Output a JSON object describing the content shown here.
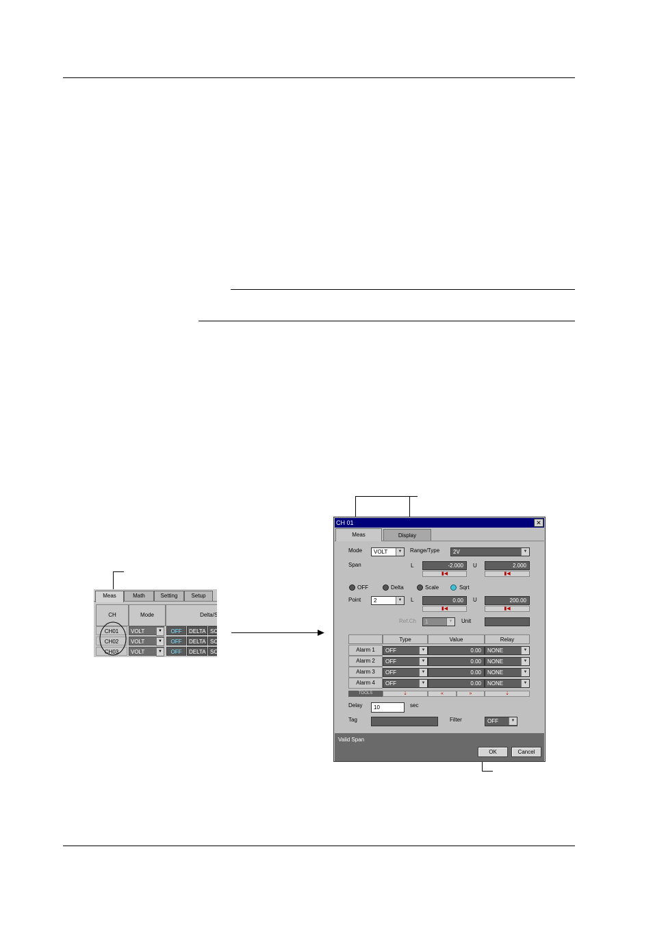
{
  "mini_table": {
    "tabs": [
      "Meas",
      "Math",
      "Setting",
      "Setup"
    ],
    "headers": {
      "ch": "CH",
      "mode": "Mode",
      "delta_scale": "Delta/Scale"
    },
    "rows": [
      {
        "ch": "CH01",
        "mode": "VOLT",
        "off": "OFF",
        "delta": "DELTA",
        "sc": "SC"
      },
      {
        "ch": "CH02",
        "mode": "VOLT",
        "off": "OFF",
        "delta": "DELTA",
        "sc": "SC"
      },
      {
        "ch": "CH03",
        "mode": "VOLT",
        "off": "OFF",
        "delta": "DELTA",
        "sc": "SC"
      }
    ]
  },
  "dialog": {
    "title": "CH 01",
    "close_glyph": "✕",
    "tabs": [
      "Meas",
      "Display"
    ],
    "mode_label": "Mode",
    "mode_value": "VOLT",
    "range_label": "Range/Type",
    "range_value": "2V",
    "span_label": "Span",
    "l_label": "L",
    "u_label": "U",
    "span_l": "-2.000",
    "span_u": "2.000",
    "radios": [
      {
        "label": "OFF",
        "selected": false
      },
      {
        "label": "Delta",
        "selected": false
      },
      {
        "label": "Scale",
        "selected": false
      },
      {
        "label": "Sqrt",
        "selected": true
      }
    ],
    "point_label": "Point",
    "point_value": "2",
    "point_l": "0.00",
    "point_u": "200.00",
    "refch_label": "Ref.Ch",
    "refch_value": "1",
    "unit_label": "Unit",
    "unit_value": "",
    "alarm_headers": {
      "type": "Type",
      "value": "Value",
      "relay": "Relay"
    },
    "alarms": [
      {
        "name": "Alarm 1",
        "type": "OFF",
        "value": "0.00",
        "relay": "NONE"
      },
      {
        "name": "Alarm 2",
        "type": "OFF",
        "value": "0.00",
        "relay": "NONE"
      },
      {
        "name": "Alarm 3",
        "type": "OFF",
        "value": "0.00",
        "relay": "NONE"
      },
      {
        "name": "Alarm 4",
        "type": "OFF",
        "value": "0.00",
        "relay": "NONE"
      }
    ],
    "tools_label": "TOOLS",
    "delay_label": "Delay",
    "delay_value": "10",
    "delay_unit": "sec",
    "tag_label": "Tag",
    "tag_value": "",
    "filter_label": "Filter",
    "filter_value": "OFF",
    "status_text": "Valid Span",
    "ok_label": "OK",
    "cancel_label": "Cancel"
  },
  "colors": {
    "titlebar": "#00007a",
    "field": "#5e5e5e",
    "accent_off": "#7fe0ff",
    "sqrt_on": "#40c0d0"
  }
}
